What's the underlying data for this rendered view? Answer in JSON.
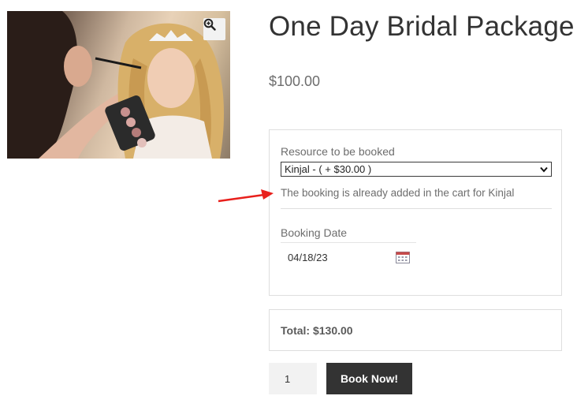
{
  "product": {
    "title": "One Day Bridal Package",
    "price": "$100.00",
    "image_icon": "zoom-in-icon"
  },
  "booking": {
    "resource_label": "Resource to be booked",
    "resource_selected": "Kinjal - ( + $30.00 )",
    "notice": "The booking is already added in the cart for Kinjal",
    "date_label": "Booking Date",
    "date_value": "04/18/23",
    "date_icon": "calendar-icon"
  },
  "total": {
    "text": "Total: $130.00"
  },
  "purchase": {
    "quantity": "1",
    "button_label": "Book Now!"
  },
  "colors": {
    "annotation_arrow": "#e8201c",
    "button_bg": "#333333"
  }
}
